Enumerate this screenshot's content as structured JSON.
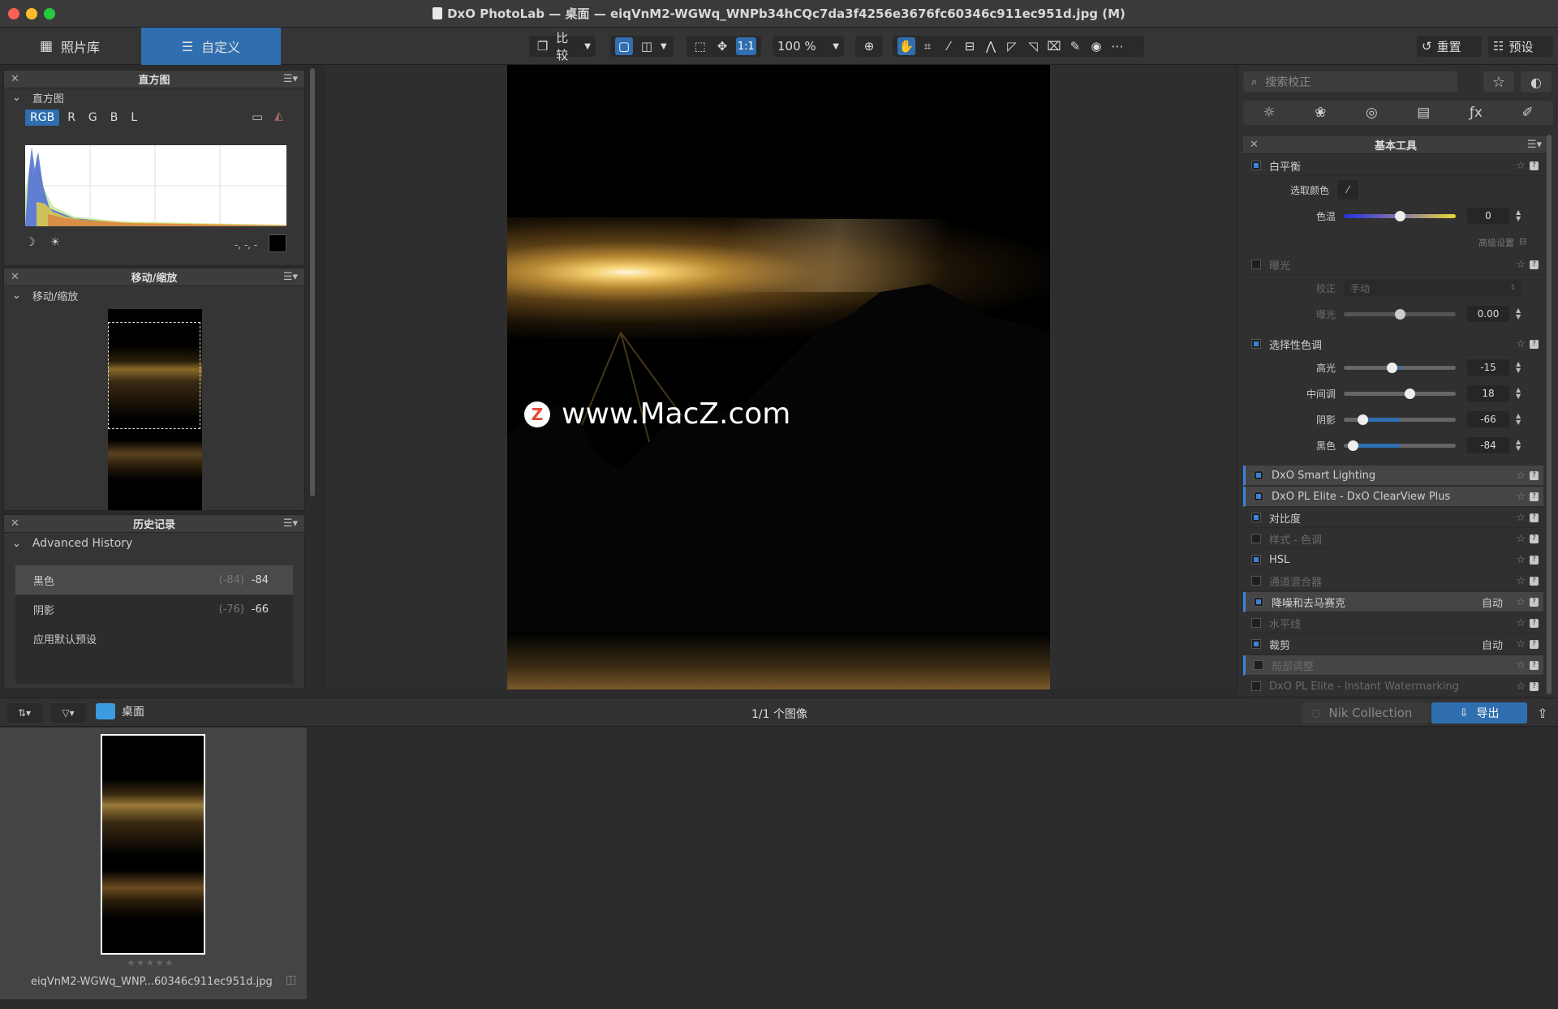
{
  "window": {
    "title": "DxO PhotoLab — 桌面 — eiqVnM2-WGWq_WNPb34hCQc7da3f4256e3676fc60346c911ec951d.jpg (M)"
  },
  "toolbar": {
    "tabs": [
      {
        "label": "照片库",
        "icon": "grid-icon"
      },
      {
        "label": "自定义",
        "icon": "sliders-icon",
        "active": true
      }
    ],
    "compare_label": "比较",
    "zoom_value": "100 %",
    "one_to_one": "1:1",
    "reset_label": "重置",
    "presets_label": "预设"
  },
  "left": {
    "histogram": {
      "title": "直方图",
      "sub": "直方图",
      "channels": [
        "RGB",
        "R",
        "G",
        "B",
        "L"
      ],
      "readout": "-, -, -"
    },
    "navigator": {
      "title": "移动/缩放",
      "sub": "移动/缩放"
    },
    "history": {
      "title": "历史记录",
      "sub": "Advanced History",
      "items": [
        {
          "label": "黑色",
          "old": "(-84)",
          "new": "-84"
        },
        {
          "label": "阴影",
          "old": "(-76)",
          "new": "-66"
        },
        {
          "label": "应用默认预设",
          "old": "",
          "new": ""
        }
      ]
    }
  },
  "watermark": "www.MacZ.com",
  "right": {
    "search_placeholder": "搜索校正",
    "panel_title": "基本工具",
    "white_balance": {
      "title": "白平衡",
      "pick_label": "选取颜色",
      "temp_label": "色温",
      "temp_value": "0",
      "advanced_label": "高级设置"
    },
    "exposure": {
      "title": "曝光",
      "mode_label": "校正",
      "mode_value": "手动",
      "exp_label": "曝光",
      "exp_value": "0.00"
    },
    "selective_tone": {
      "title": "选择性色调",
      "sliders": [
        {
          "label": "高光",
          "value": "-15",
          "level": 0.43
        },
        {
          "label": "中间调",
          "value": "18",
          "level": 0.59
        },
        {
          "label": "阴影",
          "value": "-66",
          "level": 0.17
        },
        {
          "label": "黑色",
          "value": "-84",
          "level": 0.08
        }
      ]
    },
    "tools": [
      {
        "label": "DxO Smart Lighting",
        "enabled": true,
        "auto": ""
      },
      {
        "label": "DxO PL Elite - DxO ClearView Plus",
        "enabled": true,
        "auto": ""
      },
      {
        "label": "对比度",
        "enabled": true,
        "auto": ""
      },
      {
        "label": "样式 - 色调",
        "enabled": false,
        "auto": ""
      },
      {
        "label": "HSL",
        "enabled": true,
        "auto": ""
      },
      {
        "label": "通道混合器",
        "enabled": false,
        "auto": ""
      },
      {
        "label": "降噪和去马赛克",
        "enabled": true,
        "auto": "自动"
      },
      {
        "label": "水平线",
        "enabled": false,
        "auto": ""
      },
      {
        "label": "裁剪",
        "enabled": true,
        "auto": "自动"
      },
      {
        "label": "局部调整",
        "enabled": false,
        "auto": ""
      },
      {
        "label": "DxO PL Elite - Instant Watermarking",
        "enabled": false,
        "auto": ""
      }
    ]
  },
  "bottom": {
    "folder": "桌面",
    "count": "1/1 个图像",
    "nik_label": "Nik Collection",
    "export_label": "导出"
  },
  "filmstrip": {
    "filename": "eiqVnM2-WGWq_WNP...60346c911ec951d.jpg",
    "stars": "★★★★★"
  }
}
